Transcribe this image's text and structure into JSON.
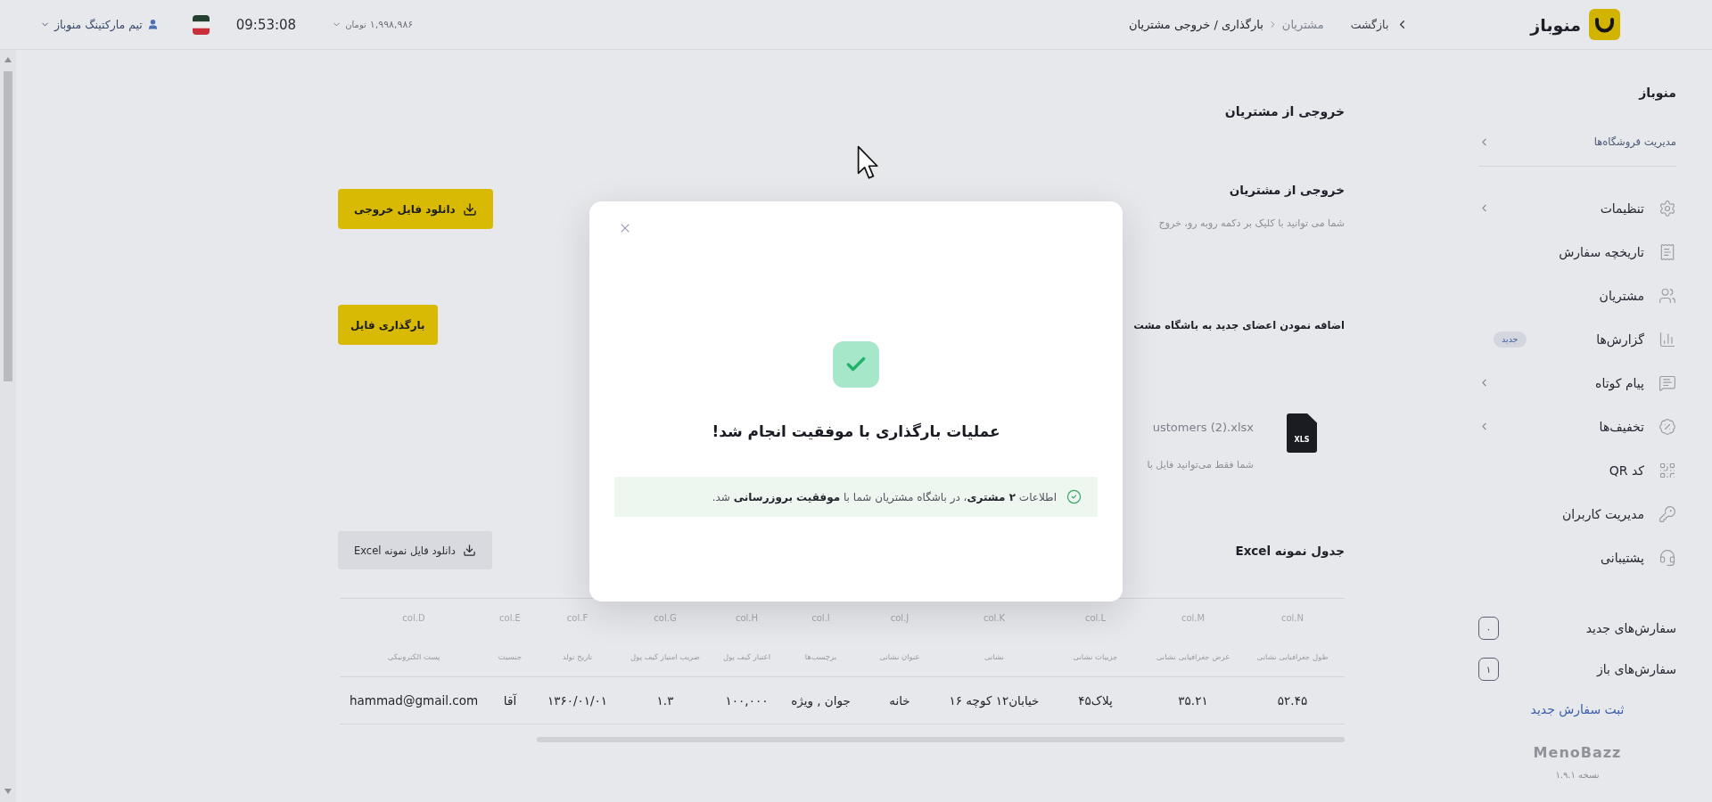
{
  "header": {
    "logo": "منوباز",
    "back_button": "بازگشت",
    "breadcrumb": [
      {
        "label": "مشتریان",
        "current": false
      },
      {
        "label": "بارگذاری / خروجی مشتریان",
        "current": true
      }
    ],
    "balance": {
      "amount": "۱,۹۹۸,۹۸۶",
      "currency": "تومان"
    },
    "time": "09:53:08",
    "account": "تیم مارکتینگ منوباز"
  },
  "sidebar": {
    "title": "منوباز",
    "store_link": {
      "label": "مدیریت فروشگاه‌ها",
      "submenu": true
    },
    "items": [
      {
        "label": "تنظیمات",
        "submenu": true
      },
      {
        "label": "تاریخچه سفارش",
        "submenu": false
      },
      {
        "label": "مشتریان",
        "submenu": false
      },
      {
        "label": "گزارش‌ها",
        "submenu": false,
        "badge": "جدید"
      },
      {
        "label": "پیام کوتاه",
        "submenu": true
      },
      {
        "label": "تخفیف‌ها",
        "submenu": true
      },
      {
        "label": "کد QR",
        "submenu": false
      },
      {
        "label": "مدیریت کاربران",
        "submenu": false
      },
      {
        "label": "پشتیبانی",
        "submenu": false
      }
    ],
    "order_counts": [
      {
        "label": "سفارش‌های جدید",
        "count": "۰"
      },
      {
        "label": "سفارش‌های باز",
        "count": "۱"
      }
    ],
    "new_order_link": "ثبت سفارش جدید",
    "brand": "MenoBazz",
    "version": "نسخه ۱.۹.۱"
  },
  "page": {
    "title": "خروجی از مشتریان",
    "export": {
      "title": "خروجی از مشتریان",
      "description": "شما می توانید با کلیک بر دکمه روبه رو، خروج",
      "button": "دانلود فایل خروجی"
    },
    "import": {
      "title": "اضافه نمودن اعضای جدید به باشگاه مشت",
      "button": "بارگذاری فایل",
      "file": {
        "type_label": "XLS",
        "name": "ustomers (2).xlsx",
        "hint": "شما فقط می‌توانید فایل با"
      }
    },
    "sample_table": {
      "title": "جدول نمونه Excel",
      "download_button": "دانلود فایل نمونه Excel",
      "columns": [
        {
          "letter": "col.N",
          "name": "طول جغرافیایی نشانی"
        },
        {
          "letter": "col.M",
          "name": "عرض جغرافیایی نشانی"
        },
        {
          "letter": "col.L",
          "name": "جزییات نشانی"
        },
        {
          "letter": "col.K",
          "name": "نشانی"
        },
        {
          "letter": "col.J",
          "name": "عنوان نشانی"
        },
        {
          "letter": "col.I",
          "name": "برچسب‌ها"
        },
        {
          "letter": "col.H",
          "name": "اعتبار کیف پول"
        },
        {
          "letter": "col.G",
          "name": "ضریب امتیاز کیف پول"
        },
        {
          "letter": "col.F",
          "name": "تاریخ تولد"
        },
        {
          "letter": "col.E",
          "name": "جنسیت"
        },
        {
          "letter": "col.D",
          "name": "پست الکترونیکی"
        }
      ],
      "rows": [
        [
          "۵۲.۴۵",
          "۳۵.۲۱",
          "پلاک۴۵",
          "خیابان۱۲ کوچه ۱۶",
          "خانه",
          "جوان , ویژه",
          "۱۰۰,۰۰۰",
          "۱.۳",
          "۱۳۶۰/۰۱/۰۱",
          "آقا",
          "hammad@gmail.com"
        ]
      ]
    }
  },
  "dialog": {
    "kind": "success",
    "title": "عملیات بارگذاری با موفقیت انجام شد!",
    "message": "اطلاعات **۲ مشتری**، در باشگاه مشتریان شما با **موفقیت بروزرسانی** شد."
  }
}
